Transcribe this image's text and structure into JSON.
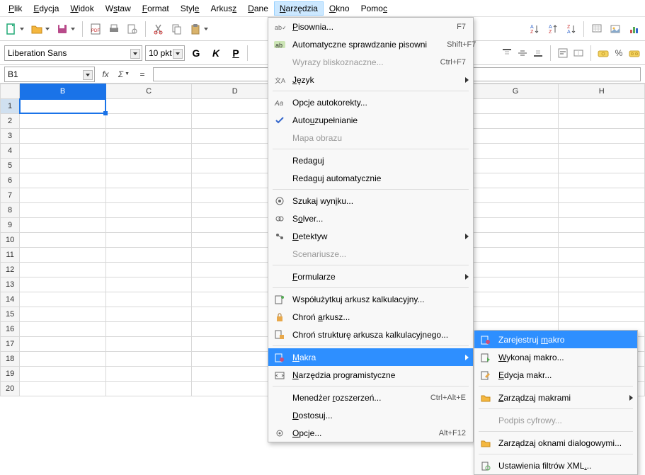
{
  "menubar": {
    "items": [
      {
        "label": "Plik",
        "u": 0
      },
      {
        "label": "Edycja",
        "u": 0
      },
      {
        "label": "Widok",
        "u": 0
      },
      {
        "label": "Wstaw",
        "u": 1
      },
      {
        "label": "Format",
        "u": 0
      },
      {
        "label": "Style",
        "u": 4
      },
      {
        "label": "Arkusz",
        "u": 5
      },
      {
        "label": "Dane",
        "u": 0
      },
      {
        "label": "Narzędzia",
        "u": 0,
        "active": true
      },
      {
        "label": "Okno",
        "u": 0
      },
      {
        "label": "Pomoc",
        "u": 4
      }
    ]
  },
  "toolbar": {
    "icons": [
      "new-file-icon",
      "open-folder-icon",
      "save-icon",
      "export-pdf-icon",
      "print-icon",
      "print-preview-icon",
      "cut-icon",
      "copy-icon",
      "paste-icon"
    ]
  },
  "toolbar_right": {
    "icons": [
      "sort-icon",
      "sort-asc-icon",
      "sort-desc-icon",
      "filter-icon",
      "image-icon",
      "chart-icon"
    ]
  },
  "toolbar2": {
    "font_name": "Liberation Sans",
    "font_size": "10 pkt",
    "bold": "G",
    "italic": "K",
    "underline": "P"
  },
  "toolbar2_right": {
    "icons": [
      "align-top-icon",
      "align-middle-icon",
      "align-bottom-icon",
      "wrap-icon",
      "merge-icon",
      "currency-icon",
      "percent-icon",
      "number-icon"
    ]
  },
  "formulabar": {
    "cell_ref": "B1",
    "fx": "fx",
    "sigma": "Σ",
    "eq": "="
  },
  "sheet": {
    "columns": [
      "B",
      "C",
      "D",
      "G",
      "H"
    ],
    "rows": [
      1,
      2,
      3,
      4,
      5,
      6,
      7,
      8,
      9,
      10,
      11,
      12,
      13,
      14,
      15,
      16,
      17,
      18,
      19,
      20
    ],
    "selected_col": "B",
    "selected_row": 1
  },
  "menu_tools": {
    "items": [
      {
        "icon": "abc-icon",
        "label": "Pisownia...",
        "u": 0,
        "shortcut": "F7"
      },
      {
        "icon": "abc-check-icon",
        "label": "Automatyczne sprawdzanie pisowni",
        "shortcut": "Shift+F7"
      },
      {
        "label": "Wyrazy bliskoznaczne...",
        "shortcut": "Ctrl+F7",
        "disabled": true
      },
      {
        "icon": "language-icon",
        "label": "Język",
        "u": 0,
        "sub": true
      },
      {
        "sep": true
      },
      {
        "icon": "autocorrect-icon",
        "label": "Opcje autokorekty...",
        "u": -1
      },
      {
        "icon": "check-icon",
        "label": "Autouzupełnianie",
        "u": 4
      },
      {
        "label": "Mapa obrazu",
        "disabled": true
      },
      {
        "sep": true
      },
      {
        "label": "Redaguj"
      },
      {
        "label": "Redaguj automatycznie"
      },
      {
        "sep": true
      },
      {
        "icon": "goal-icon",
        "label": "Szukaj wyniku...",
        "u": 10
      },
      {
        "icon": "solver-icon",
        "label": "Solver...",
        "u": 1
      },
      {
        "icon": "detective-icon",
        "label": "Detektyw",
        "u": 0,
        "sub": true
      },
      {
        "label": "Scenariusze...",
        "disabled": true
      },
      {
        "sep": true
      },
      {
        "label": "Formularze",
        "u": 0,
        "sub": true
      },
      {
        "sep": true
      },
      {
        "icon": "share-icon",
        "label": "Współużytkuj arkusz kalkulacyjny..."
      },
      {
        "icon": "lock-icon",
        "label": "Chroń arkusz...",
        "u": 6
      },
      {
        "icon": "lock-doc-icon",
        "label": "Chroń strukturę arkusza kalkulacyjnego..."
      },
      {
        "sep": true
      },
      {
        "icon": "macro-icon",
        "label": "Makra",
        "u": 0,
        "sub": true,
        "highlight": true
      },
      {
        "icon": "dev-icon",
        "label": "Narzędzia programistyczne",
        "u": 0
      },
      {
        "sep": true
      },
      {
        "label": "Menedżer rozszerzeń...",
        "u": 9,
        "shortcut": "Ctrl+Alt+E"
      },
      {
        "label": "Dostosuj...",
        "u": 0
      },
      {
        "icon": "gear-icon",
        "label": "Opcje...",
        "u": 0,
        "shortcut": "Alt+F12"
      }
    ]
  },
  "menu_macros": {
    "items": [
      {
        "icon": "record-icon",
        "label": "Zarejestruj makro",
        "u": 12,
        "highlight": true
      },
      {
        "icon": "play-icon",
        "label": "Wykonaj makro...",
        "u": 0
      },
      {
        "icon": "edit-macro-icon",
        "label": "Edycja makr...",
        "u": 0
      },
      {
        "sep": true
      },
      {
        "icon": "manage-icon",
        "label": "Zarządzaj makrami",
        "u": 0,
        "sub": true
      },
      {
        "sep": true
      },
      {
        "label": "Podpis cyfrowy...",
        "disabled": true
      },
      {
        "sep": true
      },
      {
        "icon": "dialog-icon",
        "label": "Zarządzaj oknami dialogowymi..."
      },
      {
        "sep": true
      },
      {
        "icon": "xml-icon",
        "label": "Ustawienia filtrów XML...",
        "u": 22
      }
    ]
  }
}
